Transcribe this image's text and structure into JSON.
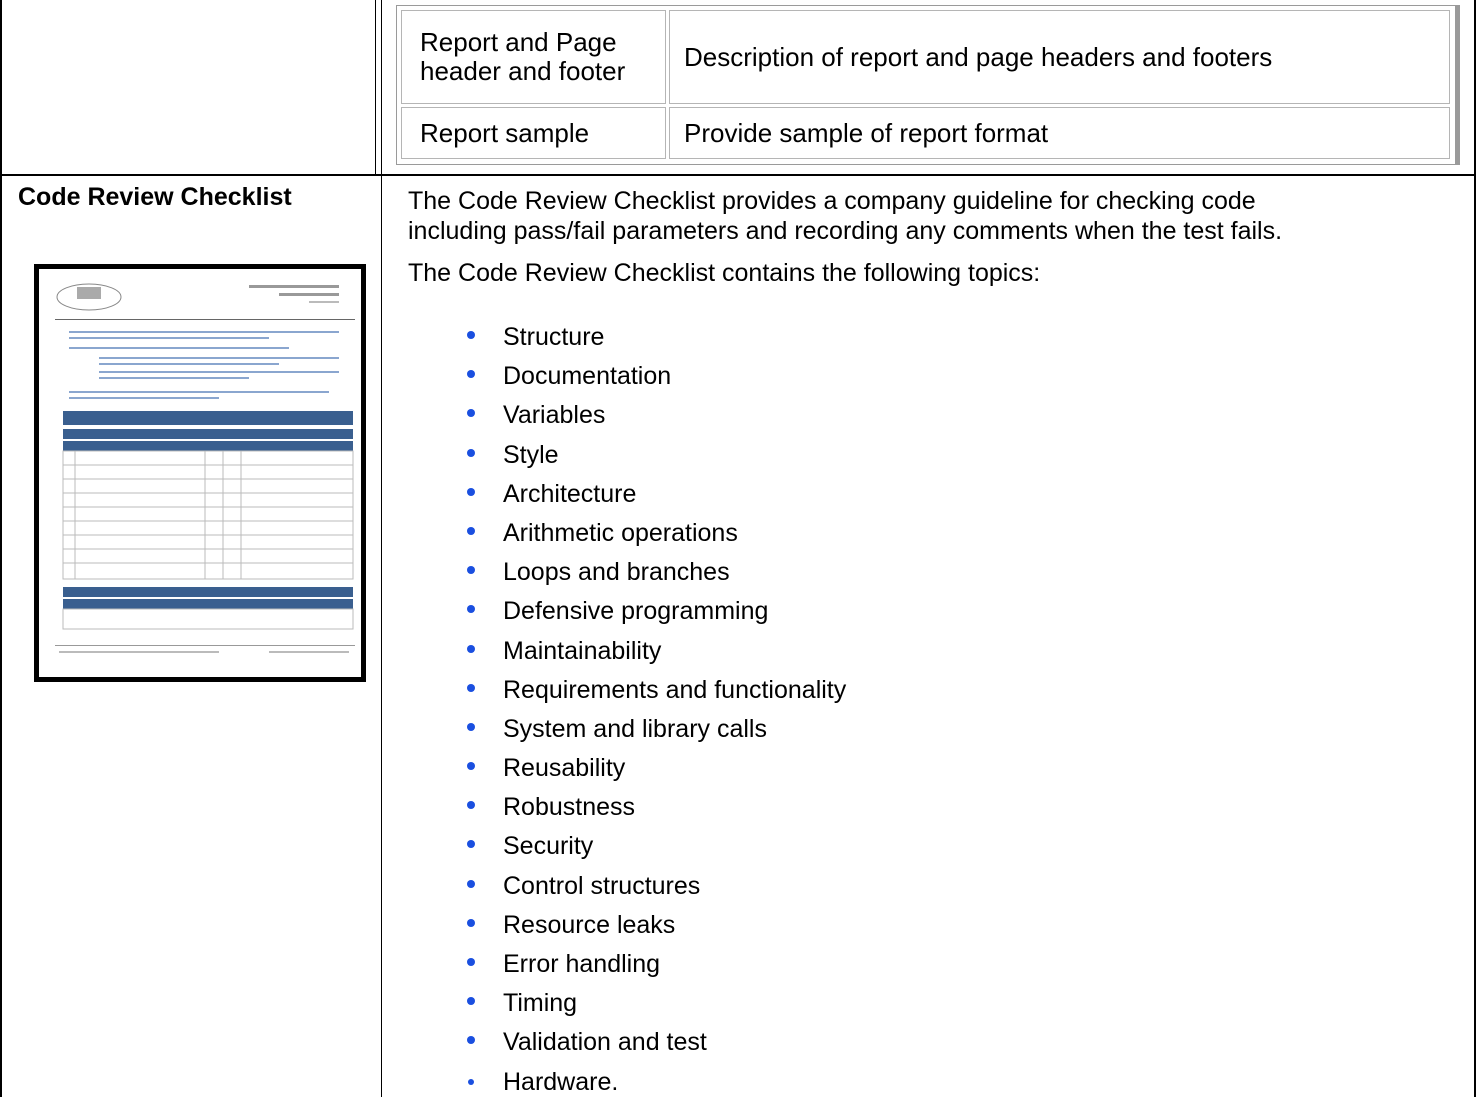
{
  "nested_table": {
    "rows": [
      {
        "label": "Report and Page header and footer",
        "label_line1": "Report and Page",
        "label_line2": "header and footer",
        "description": "Description of report and page headers and footers"
      },
      {
        "label": "Report sample",
        "description": "Provide sample of report format"
      }
    ]
  },
  "section": {
    "title": "Code Review Checklist",
    "intro_line1": "The Code Review Checklist provides a company guideline for checking code",
    "intro_line2": "including pass/fail parameters and recording any comments when the test fails.",
    "contains_text": "The Code Review Checklist contains the following topics:",
    "topics": [
      "Structure",
      "Documentation",
      "Variables",
      "Style",
      "Architecture",
      "Arithmetic operations",
      "Loops and branches",
      "Defensive programming",
      "Maintainability",
      "Requirements and functionality",
      "System and library calls",
      "Reusability",
      "Robustness",
      "Security",
      "Control structures",
      "Resource leaks",
      "Error handling",
      "Timing",
      "Validation and test",
      "Hardware."
    ]
  },
  "colors": {
    "bullet": "#1a4fe0",
    "thumbnail_header": "#3a5f8f"
  }
}
